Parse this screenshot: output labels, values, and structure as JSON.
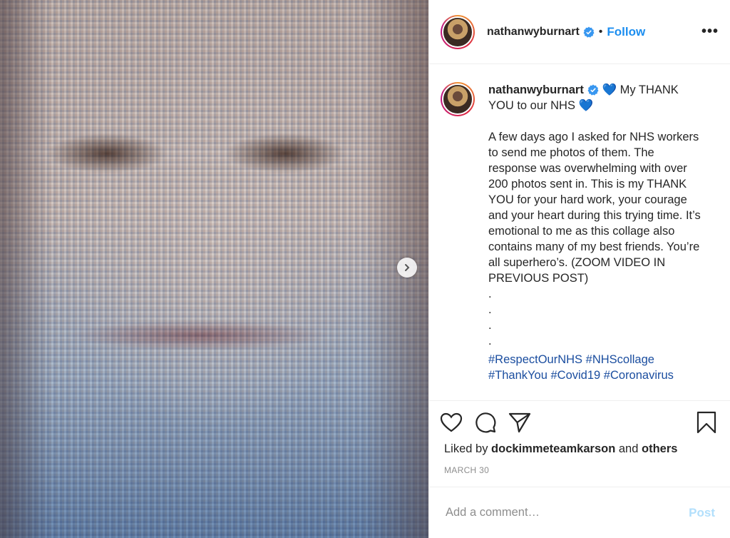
{
  "post": {
    "username": "nathanwyburnart",
    "follow_label": "Follow",
    "dot_separator": "•",
    "more_label": "•••",
    "caption": {
      "title_heart_1": "💙",
      "title_text": " My THANK YOU to our NHS ",
      "title_heart_2": "💙",
      "body": "A few days ago I asked for NHS workers to send me photos of them. The response was overwhelming with over 200 photos sent in. This is my THANK YOU for your hard work, your courage and your heart during this trying time. It’s emotional to me as this collage also contains many of my best friends. You’re all superhero’s. (ZOOM VIDEO IN PREVIOUS POST)\n.\n.\n.\n.\n",
      "hashtags": [
        "#RespectOurNHS",
        "#NHScollage",
        "#ThankYou",
        "#Covid19",
        "#Coronavirus"
      ]
    },
    "likes_prefix": "Liked by ",
    "likes_user": "dockimmeteamkarson",
    "likes_and": " and ",
    "likes_others": "others",
    "date": "MARCH 30",
    "comment_placeholder": "Add a comment…",
    "post_label": "Post"
  },
  "colors": {
    "link_blue": "#1a4d9f",
    "follow_blue": "#1c8ef0",
    "post_disabled": "#b2dffc",
    "muted": "#8e8e8e"
  },
  "icons": [
    "chevron-right-icon",
    "verified-badge-icon",
    "heart-icon",
    "comment-icon",
    "share-icon",
    "bookmark-icon",
    "more-icon"
  ]
}
